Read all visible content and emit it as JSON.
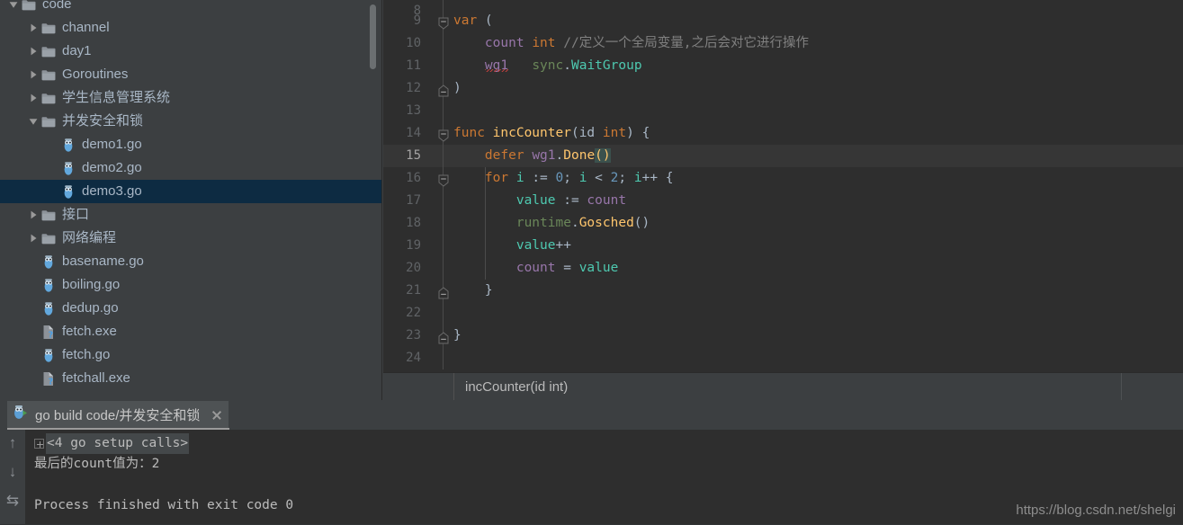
{
  "theme": {
    "editor_bg": "#2e2e2e",
    "panel_bg": "#3c3f41",
    "selection_bg": "#0d2b42",
    "current_line_bg": "#363636",
    "text_fg": "#a9b7c6",
    "keyword": "#cc7832",
    "function": "#ffc66d",
    "number": "#6897bb",
    "comment": "#808080",
    "field": "#9876aa",
    "local": "#4ec9b0",
    "package": "#6a8759"
  },
  "project_tree": {
    "name": "project-tree",
    "scrollbar_visible": true,
    "items": [
      {
        "label": "code",
        "depth": 0,
        "type": "folder",
        "expander": "down",
        "selected": false
      },
      {
        "label": "channel",
        "depth": 1,
        "type": "folder",
        "expander": "right",
        "selected": false
      },
      {
        "label": "day1",
        "depth": 1,
        "type": "folder",
        "expander": "right",
        "selected": false
      },
      {
        "label": "Goroutines",
        "depth": 1,
        "type": "folder",
        "expander": "right",
        "selected": false
      },
      {
        "label": "学生信息管理系统",
        "depth": 1,
        "type": "folder",
        "expander": "right",
        "selected": false
      },
      {
        "label": "并发安全和锁",
        "depth": 1,
        "type": "folder",
        "expander": "down",
        "selected": false
      },
      {
        "label": "demo1.go",
        "depth": 2,
        "type": "go",
        "expander": "none",
        "selected": false
      },
      {
        "label": "demo2.go",
        "depth": 2,
        "type": "go",
        "expander": "none",
        "selected": false
      },
      {
        "label": "demo3.go",
        "depth": 2,
        "type": "go",
        "expander": "none",
        "selected": true
      },
      {
        "label": "接口",
        "depth": 1,
        "type": "folder",
        "expander": "right",
        "selected": false
      },
      {
        "label": "网络编程",
        "depth": 1,
        "type": "folder",
        "expander": "right",
        "selected": false
      },
      {
        "label": "basename.go",
        "depth": 1,
        "type": "go",
        "expander": "none",
        "selected": false
      },
      {
        "label": "boiling.go",
        "depth": 1,
        "type": "go",
        "expander": "none",
        "selected": false
      },
      {
        "label": "dedup.go",
        "depth": 1,
        "type": "go",
        "expander": "none",
        "selected": false
      },
      {
        "label": "fetch.exe",
        "depth": 1,
        "type": "exe",
        "expander": "none",
        "selected": false
      },
      {
        "label": "fetch.go",
        "depth": 1,
        "type": "go",
        "expander": "none",
        "selected": false
      },
      {
        "label": "fetchall.exe",
        "depth": 1,
        "type": "exe",
        "expander": "none",
        "selected": false
      }
    ]
  },
  "editor": {
    "name": "code-editor",
    "language": "go",
    "first_visible_line": 8,
    "caret_line": 15,
    "lines": [
      {
        "num": 8,
        "fold": "none",
        "partial": true,
        "tokens": []
      },
      {
        "num": 9,
        "fold": "open",
        "tokens": [
          {
            "t": "var",
            "c": "t-kw"
          },
          {
            "t": " (",
            "c": "t-pun"
          }
        ]
      },
      {
        "num": 10,
        "fold": "none",
        "tokens": [
          {
            "t": "    ",
            "c": "t-pun"
          },
          {
            "t": "count",
            "c": "t-fld"
          },
          {
            "t": " ",
            "c": "t-pun"
          },
          {
            "t": "int",
            "c": "t-kw"
          },
          {
            "t": " ",
            "c": "t-pun"
          },
          {
            "t": "//定义一个全局变量,之后会对它进行操作",
            "c": "t-cmt"
          }
        ]
      },
      {
        "num": 11,
        "fold": "none",
        "tokens": [
          {
            "t": "    ",
            "c": "t-pun"
          },
          {
            "t": "wg1",
            "c": "t-err"
          },
          {
            "t": "   ",
            "c": "t-pun"
          },
          {
            "t": "sync",
            "c": "t-pkg"
          },
          {
            "t": ".",
            "c": "t-pun"
          },
          {
            "t": "WaitGroup",
            "c": "t-loc"
          }
        ]
      },
      {
        "num": 12,
        "fold": "close",
        "tokens": [
          {
            "t": ")",
            "c": "t-pun"
          }
        ]
      },
      {
        "num": 13,
        "fold": "none",
        "tokens": []
      },
      {
        "num": 14,
        "fold": "open",
        "tokens": [
          {
            "t": "func",
            "c": "t-kw"
          },
          {
            "t": " ",
            "c": "t-pun"
          },
          {
            "t": "incCounter",
            "c": "t-fn"
          },
          {
            "t": "(",
            "c": "t-pun"
          },
          {
            "t": "id",
            "c": "t-id"
          },
          {
            "t": " ",
            "c": "t-pun"
          },
          {
            "t": "int",
            "c": "t-kw"
          },
          {
            "t": ") {",
            "c": "t-pun"
          }
        ]
      },
      {
        "num": 15,
        "fold": "none",
        "current": true,
        "tokens": [
          {
            "t": "    ",
            "c": "t-pun"
          },
          {
            "t": "defer",
            "c": "t-kw"
          },
          {
            "t": " ",
            "c": "t-pun"
          },
          {
            "t": "wg1",
            "c": "t-var"
          },
          {
            "t": ".",
            "c": "t-pun"
          },
          {
            "t": "Done",
            "c": "t-fn"
          },
          {
            "t": "()",
            "c": "t-fn match-brace"
          }
        ]
      },
      {
        "num": 16,
        "fold": "open",
        "indent_guide": true,
        "tokens": [
          {
            "t": "    ",
            "c": "t-pun"
          },
          {
            "t": "for",
            "c": "t-kw"
          },
          {
            "t": " ",
            "c": "t-pun"
          },
          {
            "t": "i",
            "c": "t-loc"
          },
          {
            "t": " := ",
            "c": "t-pun"
          },
          {
            "t": "0",
            "c": "t-num"
          },
          {
            "t": "; ",
            "c": "t-pun"
          },
          {
            "t": "i",
            "c": "t-loc"
          },
          {
            "t": " < ",
            "c": "t-pun"
          },
          {
            "t": "2",
            "c": "t-num"
          },
          {
            "t": "; ",
            "c": "t-pun"
          },
          {
            "t": "i",
            "c": "t-loc"
          },
          {
            "t": "++ {",
            "c": "t-pun"
          }
        ]
      },
      {
        "num": 17,
        "fold": "none",
        "indent_guide": true,
        "tokens": [
          {
            "t": "        ",
            "c": "t-pun"
          },
          {
            "t": "value",
            "c": "t-loc"
          },
          {
            "t": " := ",
            "c": "t-pun"
          },
          {
            "t": "count",
            "c": "t-fld"
          }
        ]
      },
      {
        "num": 18,
        "fold": "none",
        "indent_guide": true,
        "tokens": [
          {
            "t": "        ",
            "c": "t-pun"
          },
          {
            "t": "runtime",
            "c": "t-pkg"
          },
          {
            "t": ".",
            "c": "t-pun"
          },
          {
            "t": "Gosched",
            "c": "t-fn"
          },
          {
            "t": "()",
            "c": "t-pun"
          }
        ]
      },
      {
        "num": 19,
        "fold": "none",
        "indent_guide": true,
        "tokens": [
          {
            "t": "        ",
            "c": "t-pun"
          },
          {
            "t": "value",
            "c": "t-loc"
          },
          {
            "t": "++",
            "c": "t-pun"
          }
        ]
      },
      {
        "num": 20,
        "fold": "none",
        "indent_guide": true,
        "tokens": [
          {
            "t": "        ",
            "c": "t-pun"
          },
          {
            "t": "count",
            "c": "t-fld"
          },
          {
            "t": " = ",
            "c": "t-pun"
          },
          {
            "t": "value",
            "c": "t-loc"
          }
        ]
      },
      {
        "num": 21,
        "fold": "close",
        "tokens": [
          {
            "t": "    }",
            "c": "t-pun"
          }
        ]
      },
      {
        "num": 22,
        "fold": "none",
        "tokens": []
      },
      {
        "num": 23,
        "fold": "close",
        "tokens": [
          {
            "t": "}",
            "c": "t-pun"
          }
        ]
      },
      {
        "num": 24,
        "fold": "none",
        "tokens": []
      }
    ]
  },
  "breadcrumb": {
    "name": "breadcrumb",
    "text": "incCounter(id int)"
  },
  "run_panel": {
    "tab_label": "go build code/并发安全和锁",
    "tab_icon": "go-run-icon",
    "close_icon": "close-icon",
    "tools": [
      {
        "name": "scroll-up-icon",
        "glyph": "↑"
      },
      {
        "name": "scroll-down-icon",
        "glyph": "↓"
      },
      {
        "name": "soft-wrap-icon",
        "glyph": "⇆"
      }
    ],
    "console_lines": [
      {
        "text": "<4 go setup calls>",
        "folded": true,
        "highlight": true
      },
      {
        "text": "最后的count值为：2",
        "folded": false,
        "highlight": false
      },
      {
        "text": "",
        "folded": false,
        "highlight": false
      },
      {
        "text": "Process finished with exit code 0",
        "folded": false,
        "highlight": false
      }
    ]
  },
  "watermark": {
    "text": "https://blog.csdn.net/shelgi"
  }
}
